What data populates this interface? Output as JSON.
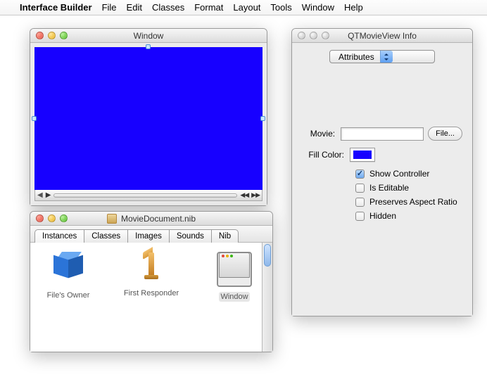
{
  "menubar": {
    "app_name": "Interface Builder",
    "items": [
      "File",
      "Edit",
      "Classes",
      "Format",
      "Layout",
      "Tools",
      "Window",
      "Help"
    ]
  },
  "preview_window": {
    "title": "Window"
  },
  "nib_window": {
    "title": "MovieDocument.nib",
    "tabs": [
      "Instances",
      "Classes",
      "Images",
      "Sounds",
      "Nib"
    ],
    "active_tab": 0,
    "objects": [
      {
        "label": "File's Owner"
      },
      {
        "label": "First Responder"
      },
      {
        "label": "Window"
      }
    ],
    "selected_index": 2
  },
  "inspector": {
    "title": "QTMovieView Info",
    "popup_label": "Attributes",
    "movie_label": "Movie:",
    "movie_value": "",
    "file_button": "File...",
    "fill_label": "Fill Color:",
    "fill_color": "#1700ff",
    "checks": [
      {
        "label": "Show Controller",
        "checked": true
      },
      {
        "label": "Is Editable",
        "checked": false
      },
      {
        "label": "Preserves Aspect Ratio",
        "checked": false
      },
      {
        "label": "Hidden",
        "checked": false
      }
    ]
  }
}
